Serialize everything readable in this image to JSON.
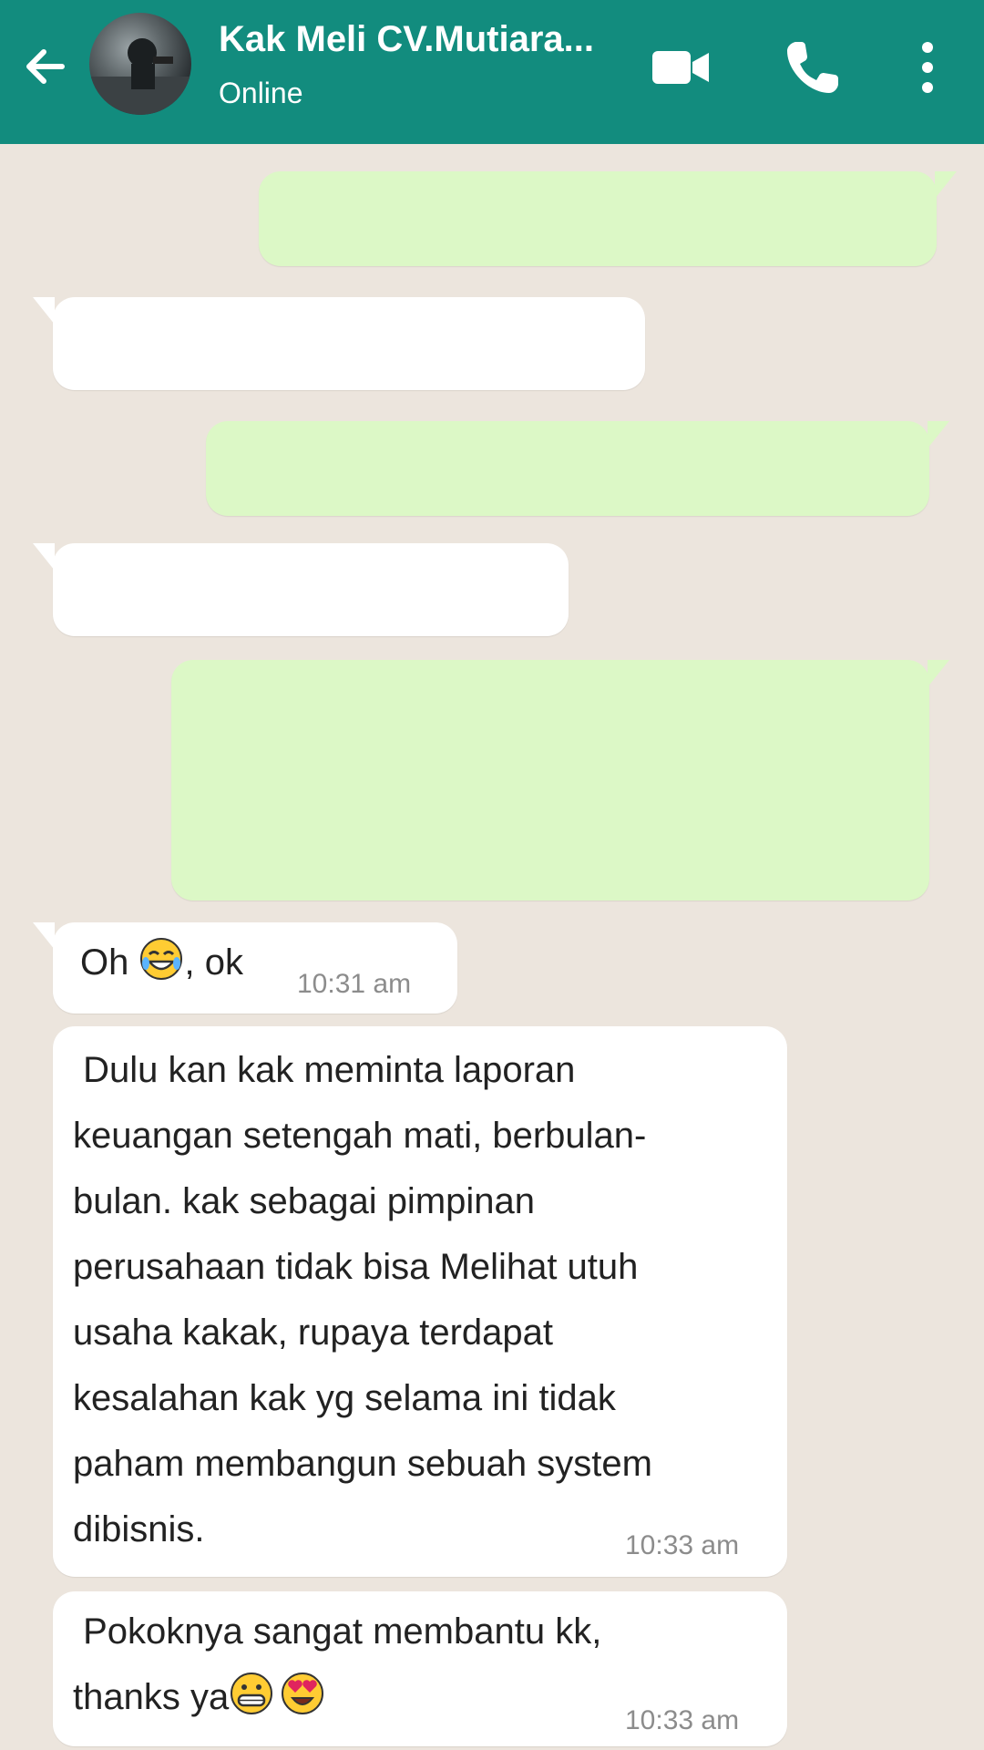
{
  "header": {
    "contact_name": "Kak Meli CV.Mutiara...",
    "status": "Online",
    "icons": {
      "back": "arrow-left-icon",
      "video": "video-camera-icon",
      "call": "phone-icon",
      "menu": "more-vertical-icon"
    },
    "colors": {
      "header_bg": "#128c7e",
      "chat_bg": "#ece5dd",
      "outgoing_bubble": "#dcf8c6",
      "incoming_bubble": "#ffffff"
    }
  },
  "messages": [
    {
      "direction": "incoming",
      "text_before": "Oh ",
      "emoji": "face-with-tears-of-joy-icon",
      "text_after": ", ok",
      "time": "10:31 am"
    },
    {
      "direction": "incoming",
      "lines": [
        " Dulu kan kak meminta laporan",
        "keuangan setengah mati, berbulan-",
        "bulan. kak sebagai pimpinan",
        "perusahaan tidak bisa Melihat utuh",
        "usaha kakak, rupaya terdapat",
        "kesalahan kak yg selama ini tidak",
        "paham membangun sebuah system",
        "dibisnis."
      ],
      "time": "10:33 am"
    },
    {
      "direction": "incoming",
      "line1": " Pokoknya sangat membantu kk,",
      "line2": "thanks ya",
      "emojis": [
        "grinning-face-icon",
        "heart-eyes-icon"
      ],
      "time": "10:33 am"
    }
  ]
}
